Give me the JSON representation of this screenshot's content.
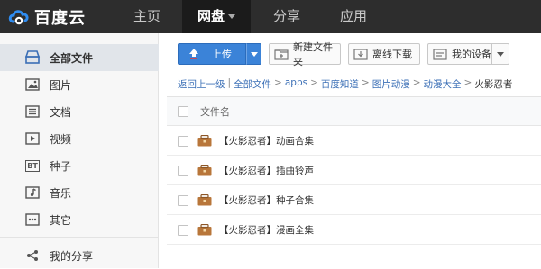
{
  "brand": {
    "name": "百度云"
  },
  "nav": {
    "home": "主页",
    "disk": "网盘",
    "share": "分享",
    "apps": "应用"
  },
  "sidebar": {
    "items": [
      {
        "label": "全部文件",
        "icon": "all-files-icon"
      },
      {
        "label": "图片",
        "icon": "image-icon"
      },
      {
        "label": "文档",
        "icon": "document-icon"
      },
      {
        "label": "视频",
        "icon": "video-icon"
      },
      {
        "label": "种子",
        "icon": "bt-icon"
      },
      {
        "label": "音乐",
        "icon": "music-icon"
      },
      {
        "label": "其它",
        "icon": "more-icon"
      },
      {
        "label": "我的分享",
        "icon": "share-icon"
      }
    ],
    "bt_glyph": "BT"
  },
  "toolbar": {
    "upload": "上传",
    "new_folder": "新建文件夹",
    "offline_download": "离线下载",
    "my_devices": "我的设备"
  },
  "breadcrumb": {
    "back": "返回上一级",
    "sep": "|",
    "arrow": ">",
    "path": [
      "全部文件",
      "apps",
      "百度知道",
      "图片动漫",
      "动漫大全"
    ],
    "current": "火影忍者"
  },
  "file_list": {
    "header": "文件名",
    "rows": [
      {
        "name": "【火影忍者】动画合集"
      },
      {
        "name": "【火影忍者】插曲铃声"
      },
      {
        "name": "【火影忍者】种子合集"
      },
      {
        "name": "【火影忍者】漫画全集"
      }
    ]
  },
  "colors": {
    "topbar": "#2d2d2d",
    "accent": "#3b83d8",
    "link": "#3b6fb6",
    "folder": "#b8763a"
  }
}
